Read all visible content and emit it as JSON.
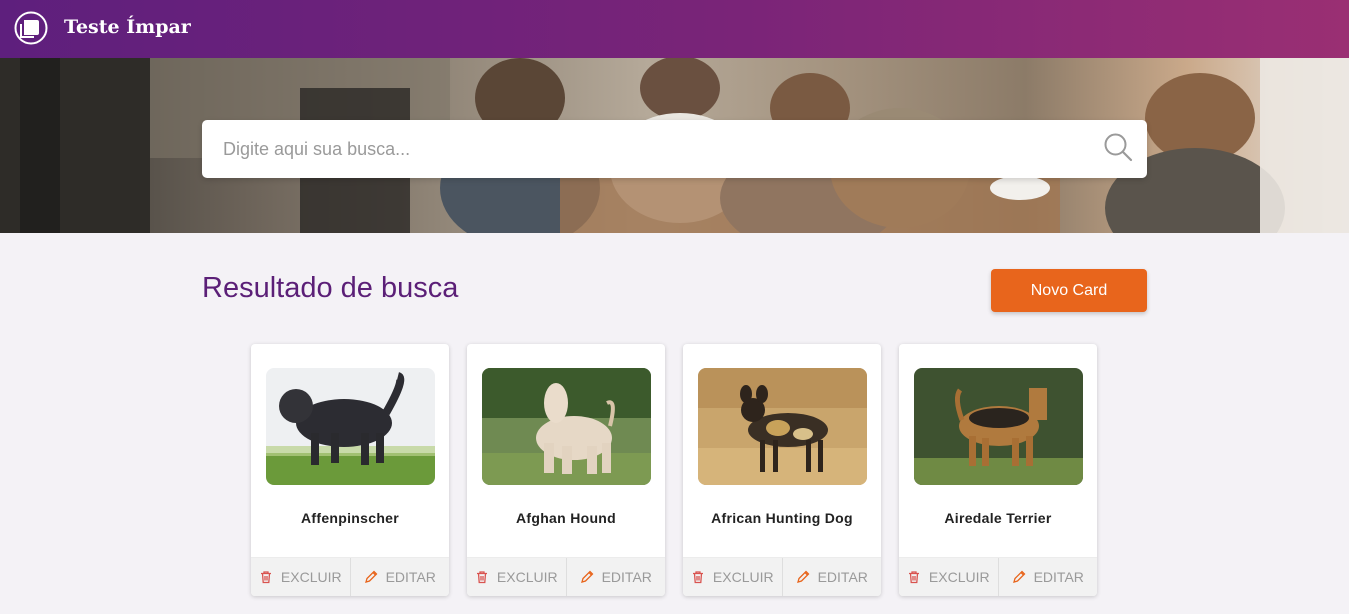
{
  "header": {
    "brand": "Teste Ímpar",
    "logo_icon": "chat-bubble-logo"
  },
  "search": {
    "placeholder": "Digite aqui sua busca...",
    "value": "",
    "icon": "search-icon"
  },
  "results": {
    "title": "Resultado de busca",
    "new_card_label": "Novo Card",
    "accent": "#e8651c"
  },
  "cards": [
    {
      "name": "Affenpinscher",
      "delete_label": "EXCLUIR",
      "edit_label": "EDITAR"
    },
    {
      "name": "Afghan Hound",
      "delete_label": "EXCLUIR",
      "edit_label": "EDITAR"
    },
    {
      "name": "African Hunting Dog",
      "delete_label": "EXCLUIR",
      "edit_label": "EDITAR"
    },
    {
      "name": "Airedale Terrier",
      "delete_label": "EXCLUIR",
      "edit_label": "EDITAR"
    }
  ],
  "colors": {
    "header_start": "#5e1f7d",
    "header_end": "#9a2f73",
    "title": "#5b1f77",
    "delete_icon": "#d9534f",
    "edit_icon": "#e8651c"
  }
}
